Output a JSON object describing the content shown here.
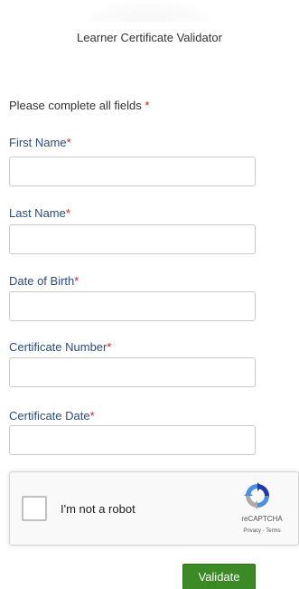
{
  "header": {
    "title": "Learner Certificate Validator"
  },
  "form": {
    "instructions": "Please complete all fields",
    "required_marker": "*",
    "fields": [
      {
        "label": "First Name",
        "value": "",
        "placeholder": ""
      },
      {
        "label": "Last Name",
        "value": "",
        "placeholder": ""
      },
      {
        "label": "Date of Birth",
        "value": "",
        "placeholder": ""
      },
      {
        "label": "Certificate Number",
        "value": "",
        "placeholder": ""
      },
      {
        "label": "Certificate Date",
        "value": "",
        "placeholder": ""
      }
    ]
  },
  "captcha": {
    "label": "I'm not a robot",
    "brand": "reCAPTCHA",
    "privacy": "Privacy",
    "separator": " - ",
    "terms": "Terms",
    "checked": false,
    "icon": "recaptcha-logo-icon"
  },
  "actions": {
    "validate_label": "Validate"
  },
  "colors": {
    "label_blue": "#2b4c7e",
    "required_red": "#d01c1c",
    "button_green": "#3b8a26"
  }
}
